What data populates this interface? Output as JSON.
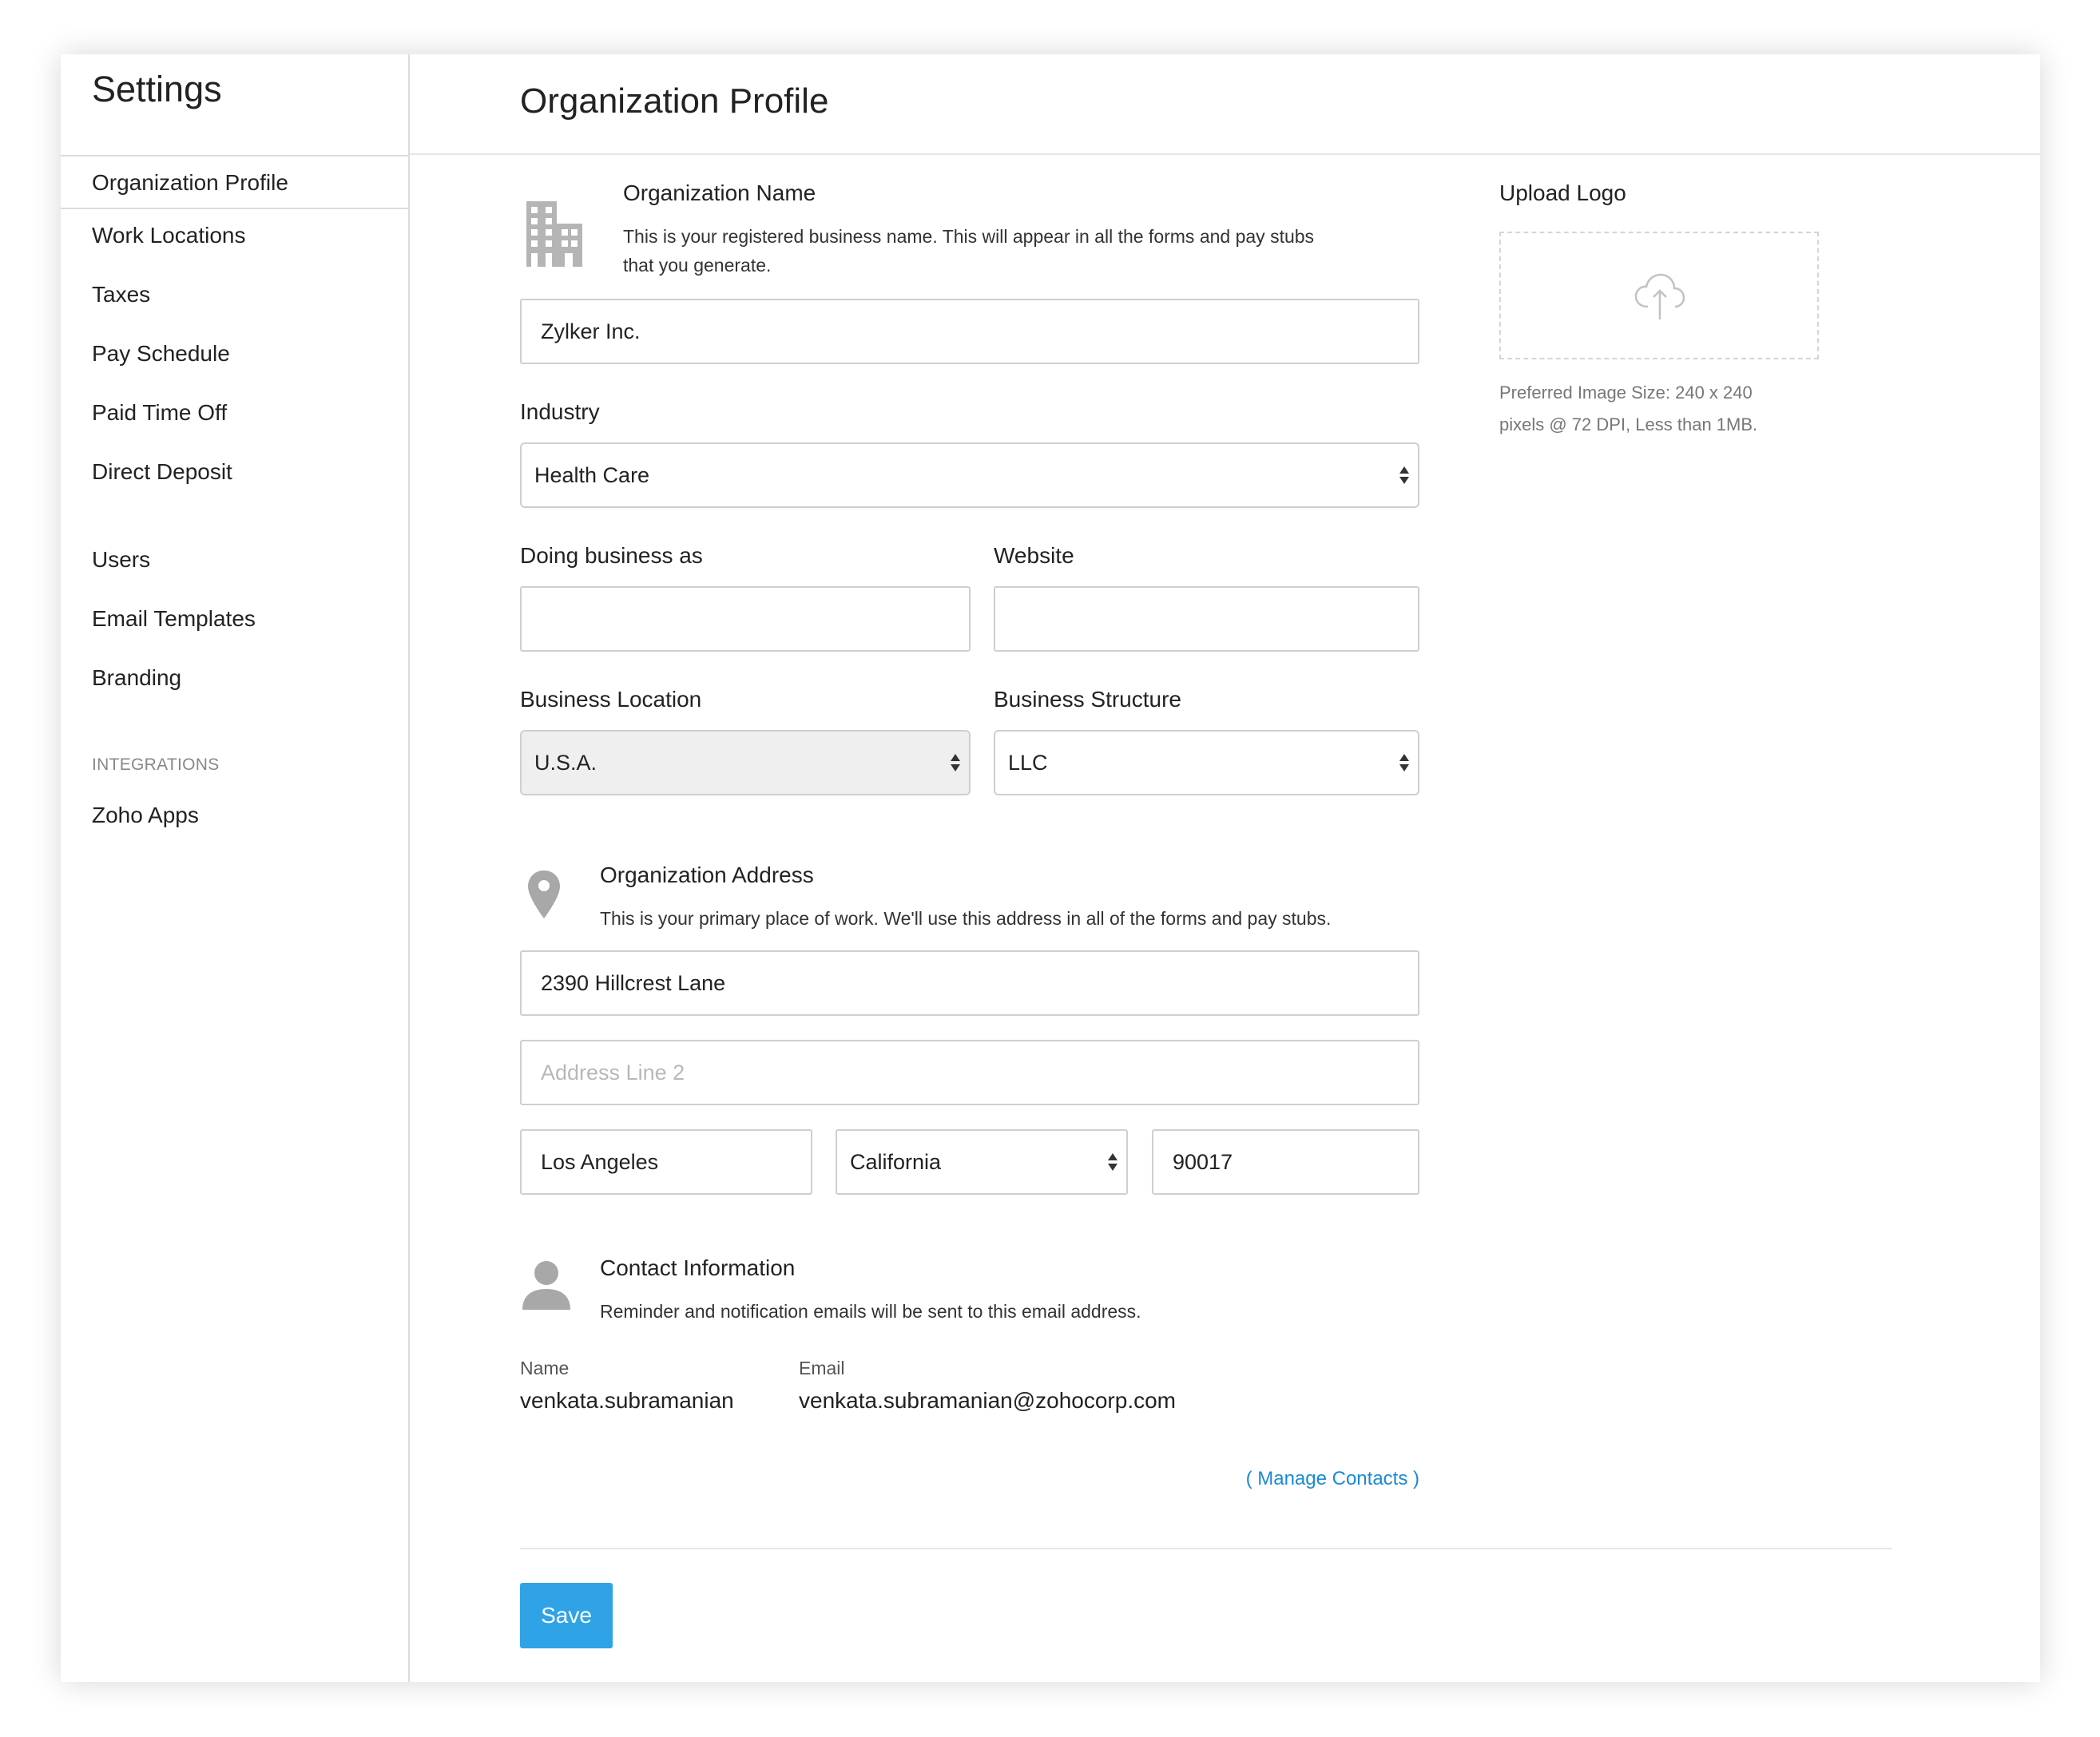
{
  "sidebar": {
    "title": "Settings",
    "items": [
      {
        "label": "Organization Profile"
      },
      {
        "label": "Work Locations"
      },
      {
        "label": "Taxes"
      },
      {
        "label": "Pay Schedule"
      },
      {
        "label": "Paid Time Off"
      },
      {
        "label": "Direct Deposit"
      },
      {
        "label": "Users"
      },
      {
        "label": "Email Templates"
      },
      {
        "label": "Branding"
      }
    ],
    "section_label": "INTEGRATIONS",
    "integration_items": [
      {
        "label": "Zoho Apps"
      }
    ]
  },
  "header": {
    "title": "Organization Profile"
  },
  "org_name": {
    "icon": "building-icon",
    "title": "Organization Name",
    "description_line1": "This is your registered business name. This will appear in all the forms and pay stubs",
    "description_line2": "that you generate.",
    "value": "Zylker Inc."
  },
  "industry": {
    "label": "Industry",
    "value": "Health Care"
  },
  "doing_business_as": {
    "label": "Doing business as",
    "value": ""
  },
  "website": {
    "label": "Website",
    "value": ""
  },
  "business_location": {
    "label": "Business Location",
    "value": "U.S.A."
  },
  "business_structure": {
    "label": "Business Structure",
    "value": "LLC"
  },
  "address": {
    "icon": "location-pin-icon",
    "title": "Organization Address",
    "description": "This is your primary place of work. We'll use this address in all of the forms and pay stubs.",
    "line1": "2390 Hillcrest Lane",
    "line2_placeholder": "Address Line 2",
    "city": "Los Angeles",
    "state": "California",
    "zip": "90017"
  },
  "contact": {
    "icon": "person-icon",
    "title": "Contact Information",
    "description": "Reminder and notification emails will be sent to this email address.",
    "name_label": "Name",
    "name_value": "venkata.subramanian",
    "email_label": "Email",
    "email_value": "venkata.subramanian@zohocorp.com",
    "manage_link": "( Manage Contacts )"
  },
  "logo": {
    "title": "Upload Logo",
    "icon": "cloud-upload-icon",
    "note_line1": "Preferred Image Size: 240 x 240",
    "note_line2": "pixels @ 72 DPI, Less than 1MB."
  },
  "actions": {
    "save_label": "Save"
  },
  "colors": {
    "accent": "#2fa3e6",
    "link": "#1a8ad6"
  }
}
